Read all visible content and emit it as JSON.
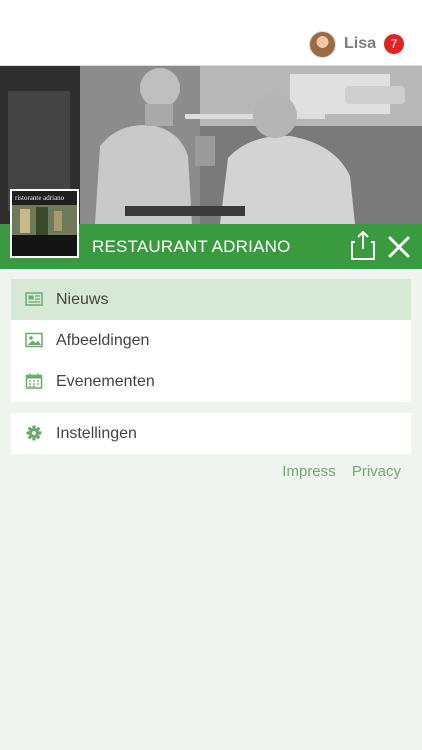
{
  "user": {
    "name": "Lisa",
    "notifications": "7"
  },
  "restaurant": {
    "name": "RESTAURANT ADRIANO",
    "logo_text": "ristorante adriano"
  },
  "menu": {
    "items": [
      {
        "label": "Nieuws",
        "icon": "newspaper-icon",
        "active": true
      },
      {
        "label": "Afbeeldingen",
        "icon": "image-icon",
        "active": false
      },
      {
        "label": "Evenementen",
        "icon": "calendar-icon",
        "active": false
      }
    ],
    "settings": {
      "label": "Instellingen",
      "icon": "gear-icon"
    }
  },
  "footer": {
    "impress": "Impress",
    "privacy": "Privacy"
  },
  "colors": {
    "accent": "#3a9a40",
    "active_bg": "#d7e9d6",
    "badge": "#e02424",
    "link": "#6caa6f"
  }
}
